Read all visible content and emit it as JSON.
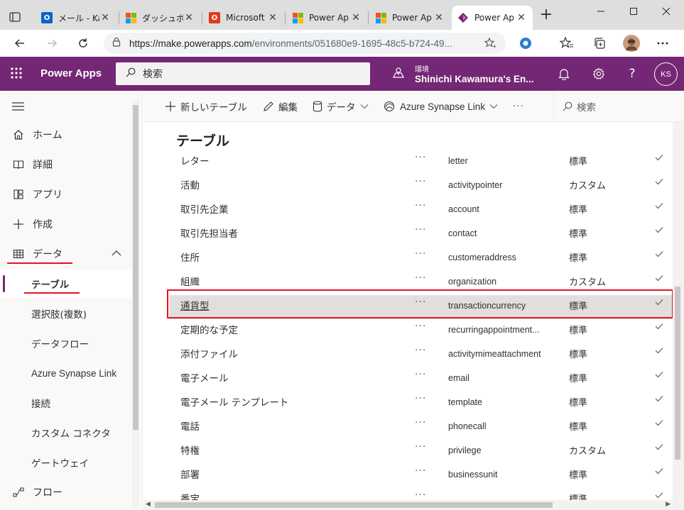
{
  "browser": {
    "tabs": [
      {
        "title": "メール - Ka",
        "icon": "outlook-icon"
      },
      {
        "title": "ダッシュボー",
        "icon": "microsoft-logo-icon"
      },
      {
        "title": "Microsoft",
        "icon": "office-icon"
      },
      {
        "title": "Power Ap",
        "icon": "microsoft-logo-icon"
      },
      {
        "title": "Power Ap",
        "icon": "microsoft-logo-icon"
      },
      {
        "title": "Power Ap",
        "icon": "power-apps-icon",
        "active": true
      }
    ],
    "url_host": "https://make.powerapps.com",
    "url_path": "/environments/051680e9-1695-48c5-b724-49..."
  },
  "header": {
    "app_name": "Power Apps",
    "search_placeholder": "検索",
    "env_label": "環境",
    "env_name": "Shinichi Kawamura's En...",
    "avatar_initials": "KS"
  },
  "leftnav": {
    "items": [
      {
        "label": "ホーム",
        "icon": "home-icon"
      },
      {
        "label": "詳細",
        "icon": "book-icon"
      },
      {
        "label": "アプリ",
        "icon": "apps-icon"
      },
      {
        "label": "作成",
        "icon": "plus-icon"
      },
      {
        "label": "データ",
        "icon": "table-icon"
      }
    ],
    "sub_items": [
      {
        "label": "テーブル",
        "selected": true
      },
      {
        "label": "選択肢(複数)"
      },
      {
        "label": "データフロー"
      },
      {
        "label": "Azure Synapse Link"
      },
      {
        "label": "接続"
      },
      {
        "label": "カスタム コネクタ"
      },
      {
        "label": "ゲートウェイ"
      }
    ],
    "flow_label": "フロー"
  },
  "commandbar": {
    "new_table": "新しいテーブル",
    "edit": "編集",
    "data": "データ",
    "azure_synapse": "Azure Synapse Link",
    "more": "···",
    "search": "検索"
  },
  "main": {
    "title": "テーブル",
    "rows": [
      {
        "name": "レター",
        "logical": "letter",
        "type": "標準"
      },
      {
        "name": "活動",
        "logical": "activitypointer",
        "type": "カスタム"
      },
      {
        "name": "取引先企業",
        "logical": "account",
        "type": "標準"
      },
      {
        "name": "取引先担当者",
        "logical": "contact",
        "type": "標準"
      },
      {
        "name": "住所",
        "logical": "customeraddress",
        "type": "標準"
      },
      {
        "name": "組織",
        "logical": "organization",
        "type": "カスタム"
      },
      {
        "name": "通貨型",
        "logical": "transactioncurrency",
        "type": "標準",
        "highlighted": true
      },
      {
        "name": "定期的な予定",
        "logical": "recurringappointment...",
        "type": "標準"
      },
      {
        "name": "添付ファイル",
        "logical": "activitymimeattachment",
        "type": "標準"
      },
      {
        "name": "電子メール",
        "logical": "email",
        "type": "標準"
      },
      {
        "name": "電子メール テンプレート",
        "logical": "template",
        "type": "標準"
      },
      {
        "name": "電話",
        "logical": "phonecall",
        "type": "標準"
      },
      {
        "name": "特権",
        "logical": "privilege",
        "type": "カスタム"
      },
      {
        "name": "部署",
        "logical": "businessunit",
        "type": "標準"
      },
      {
        "name": "番宝",
        "logical": "",
        "type": "標準"
      }
    ],
    "more_label": "···"
  },
  "colors": {
    "brand": "#742774",
    "highlight_border": "#e81123",
    "row_highlight": "#e1dfdd"
  }
}
